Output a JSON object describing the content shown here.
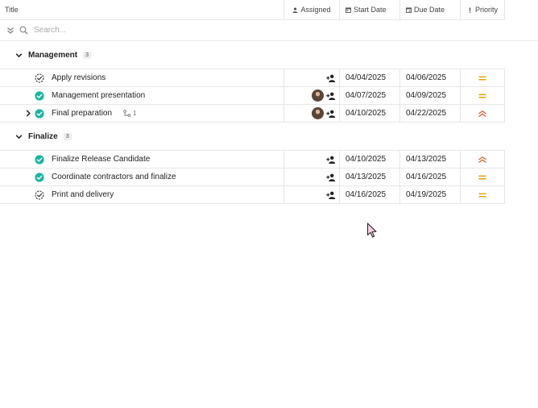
{
  "columns": {
    "title": "Title",
    "assigned": "Assigned",
    "start_date": "Start Date",
    "due_date": "Due Date",
    "priority": "Priority"
  },
  "search": {
    "placeholder": "Search..."
  },
  "colors": {
    "done": "#1bb5a0",
    "medium_priority": "#e8a400",
    "high_priority": "#e36d3b"
  },
  "groups": [
    {
      "name": "Management",
      "count": "3",
      "tasks": [
        {
          "title": "Apply revisions",
          "status": "in-progress",
          "avatar": false,
          "start": "04/04/2025",
          "due": "04/06/2025",
          "priority": "medium"
        },
        {
          "title": "Management presentation",
          "status": "done",
          "avatar": true,
          "start": "04/07/2025",
          "due": "04/09/2025",
          "priority": "medium"
        },
        {
          "title": "Final preparation",
          "status": "done",
          "avatar": true,
          "expander": true,
          "subtasks": "1",
          "start": "04/10/2025",
          "due": "04/22/2025",
          "priority": "high"
        }
      ]
    },
    {
      "name": "Finalize",
      "count": "3",
      "tasks": [
        {
          "title": "Finalize Release Candidate",
          "status": "done",
          "avatar": false,
          "start": "04/10/2025",
          "due": "04/13/2025",
          "priority": "high"
        },
        {
          "title": "Coordinate contractors and finalize",
          "status": "done",
          "avatar": false,
          "start": "04/13/2025",
          "due": "04/16/2025",
          "priority": "medium"
        },
        {
          "title": "Print and delivery",
          "status": "in-progress",
          "avatar": false,
          "start": "04/16/2025",
          "due": "04/19/2025",
          "priority": "medium"
        }
      ]
    }
  ]
}
